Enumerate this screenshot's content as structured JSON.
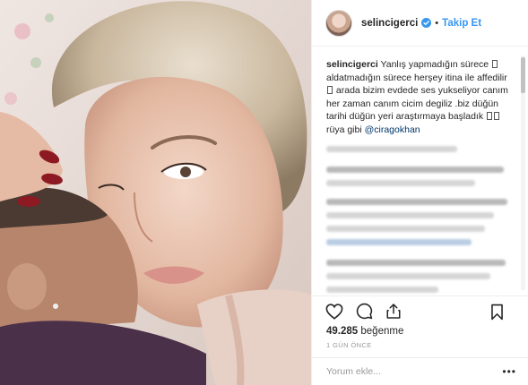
{
  "post": {
    "username": "selincigerci",
    "follow_label": "Takip Et",
    "separator": "•",
    "caption_user": "selincigerci",
    "caption_parts": [
      "Yanlış yapmadığın sürece ",
      "aldatmadığın sürece herşey itina ile affedilir ",
      " arada bizim evdede ses yukseliyor canım her zaman canım cicim degiliz .biz düğün tarihi düğün yeri araştırmaya başladık ",
      " rüya gibi "
    ],
    "mention": "@ciragokhan",
    "likes_count": "49.285",
    "likes_label": "beğenme",
    "time_ago": "1 GÜN ÖNCE",
    "comment_placeholder": "Yorum ekle...",
    "more_label": "•••"
  },
  "colors": {
    "accent": "#3897f0",
    "text": "#262626",
    "muted": "#999999",
    "border": "#efefef",
    "mention": "#003569"
  },
  "icons": [
    "verified-badge-icon",
    "heart-icon",
    "comment-icon",
    "share-icon",
    "bookmark-icon"
  ]
}
